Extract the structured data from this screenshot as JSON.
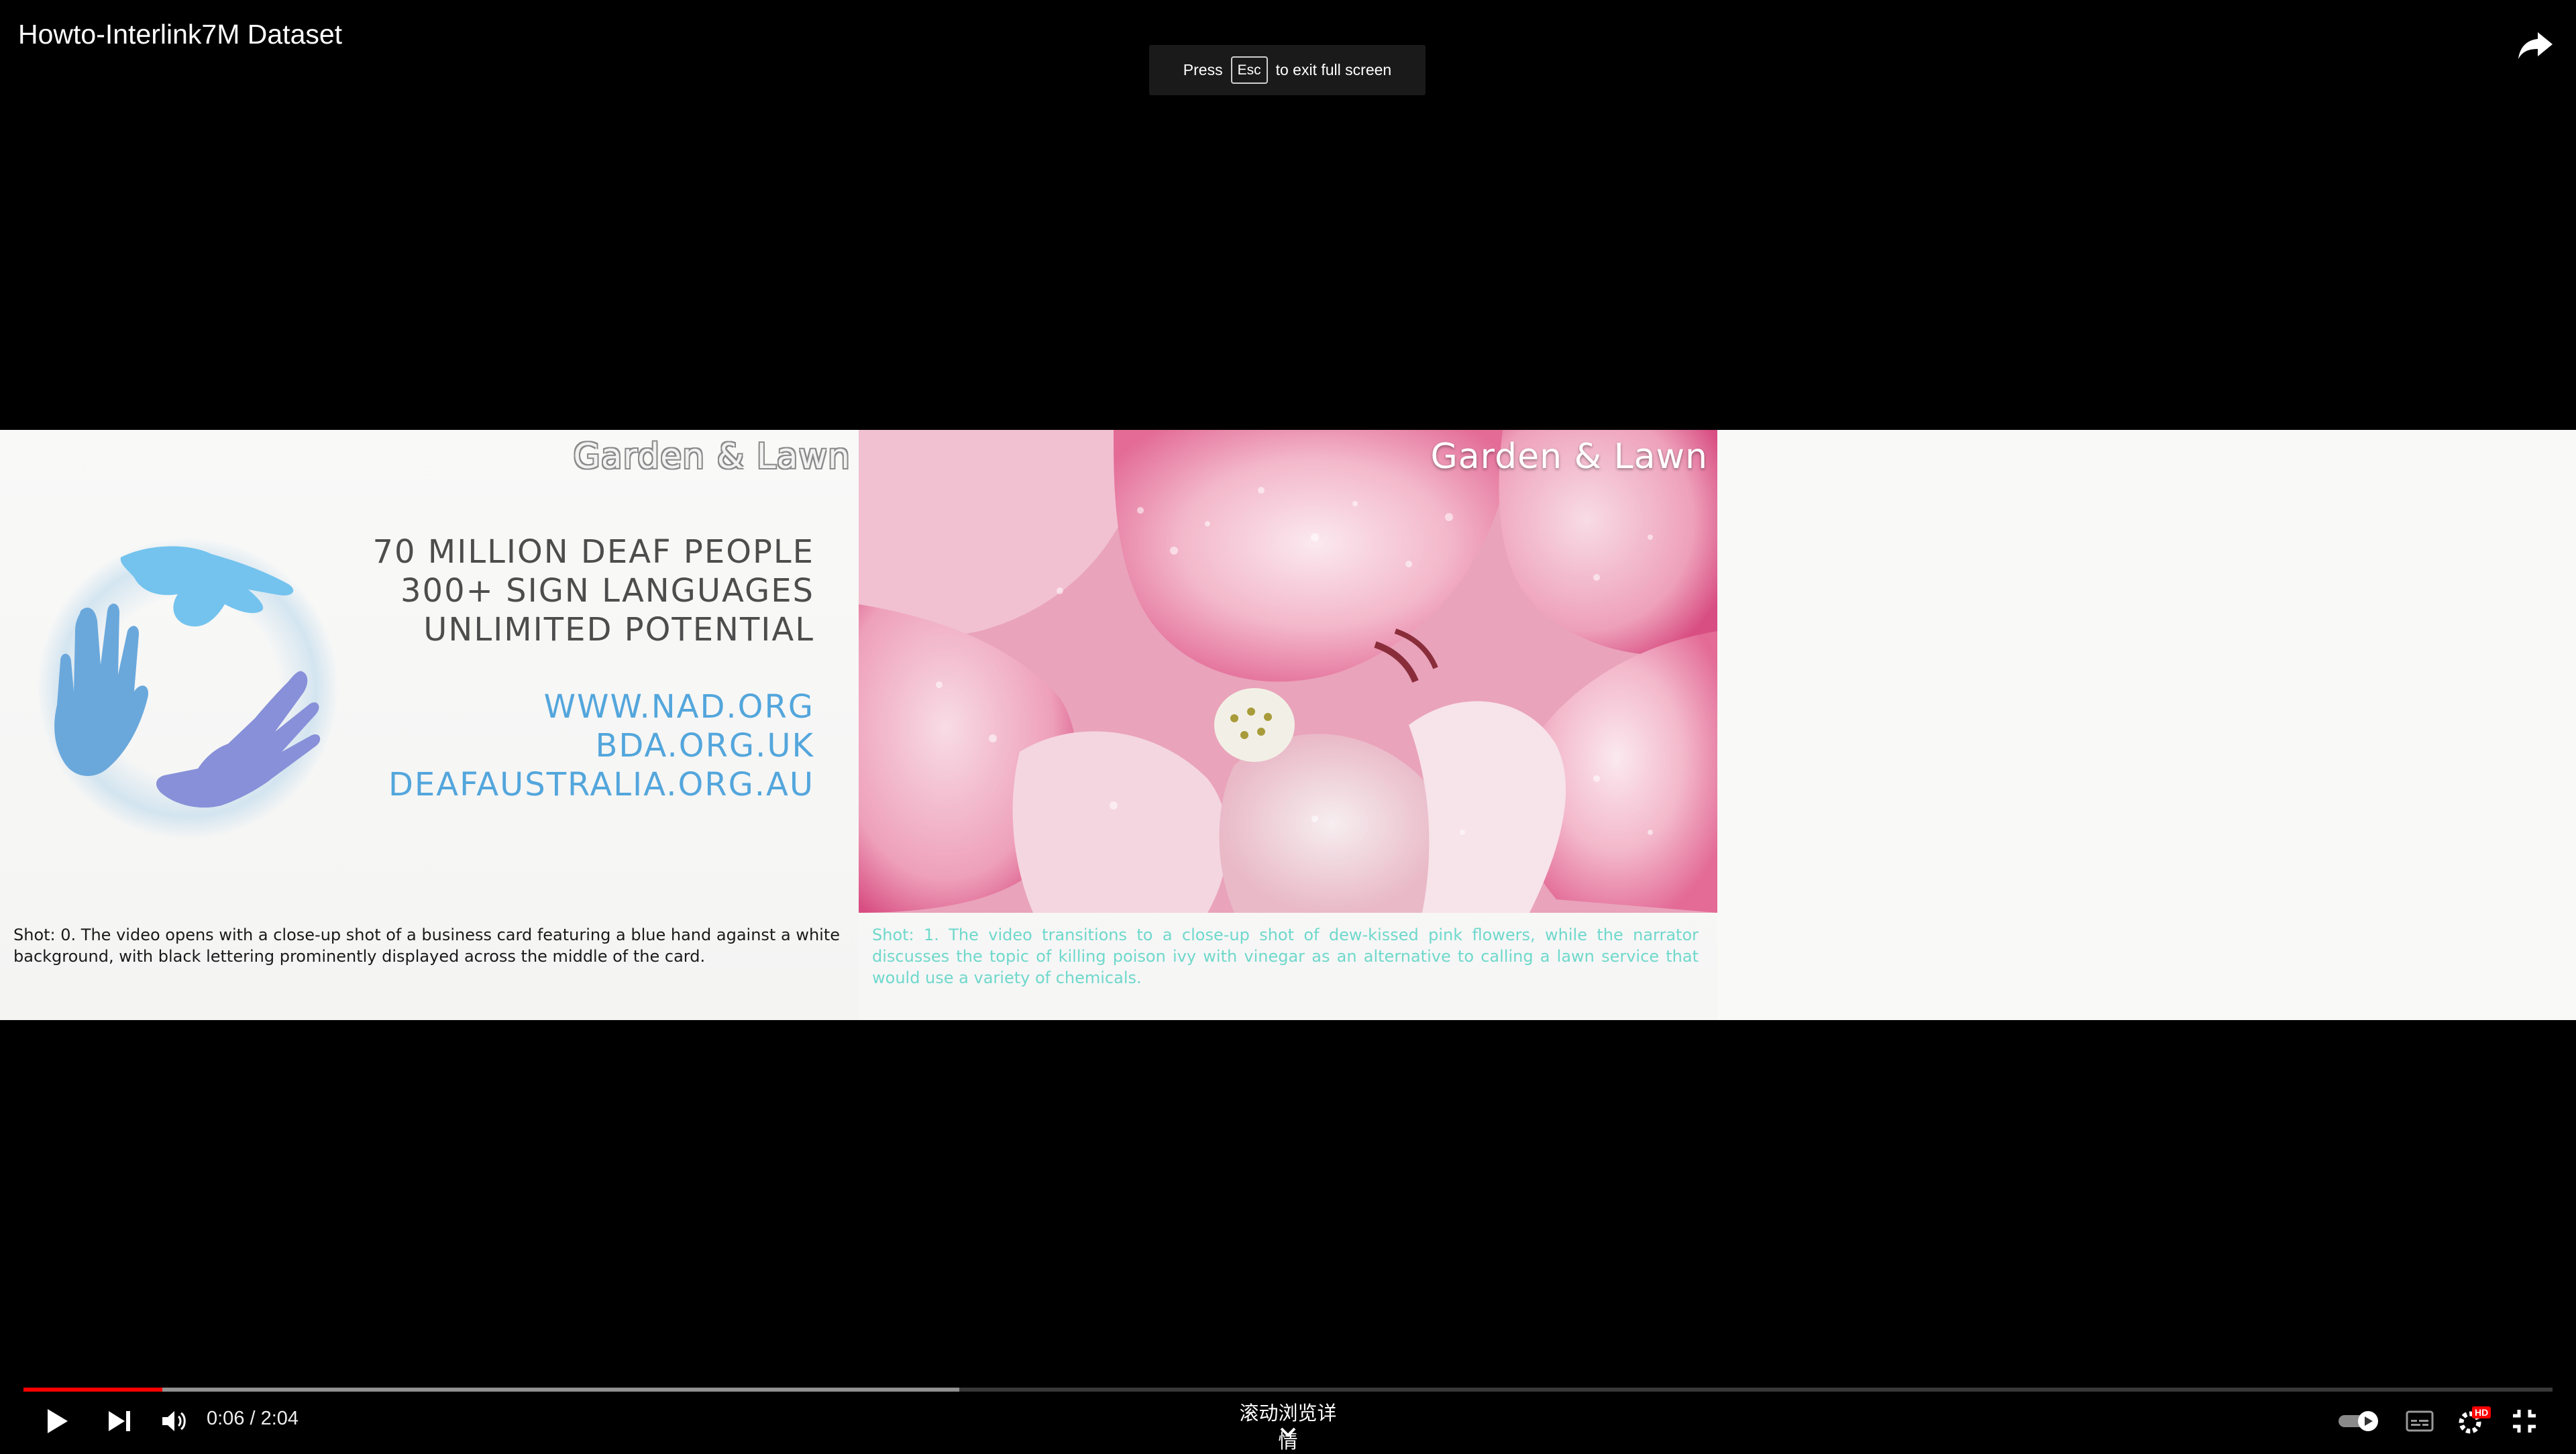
{
  "window": {
    "title": "Howto-Interlink7M Dataset"
  },
  "toast": {
    "press": "Press",
    "key": "Esc",
    "message": "to exit full screen"
  },
  "video": {
    "watermark_left": "Garden & Lawn",
    "watermark_mid": "Garden & Lawn",
    "card_lines": [
      "70 MILLION DEAF PEOPLE",
      "300+ SIGN LANGUAGES",
      "UNLIMITED POTENTIAL"
    ],
    "card_links": [
      "WWW.NAD.ORG",
      "BDA.ORG.UK",
      "DEAFAUSTRALIA.ORG.AU"
    ],
    "caption_left": "Shot: 0. The video opens with a close-up shot of a business card featuring a blue hand against a white background, with black lettering prominently displayed across the middle of the card.",
    "caption_mid": "Shot: 1. The video transitions to a close-up shot of dew-kissed pink flowers, while the narrator discusses the topic of killing poison ivy with vinegar as an alternative to calling a lawn service that would use a variety of chemicals."
  },
  "player": {
    "current_time": "0:06",
    "duration": "2:04",
    "time_display": "0:06 / 2:04",
    "progress_played": 0.055,
    "progress_buffered": 0.37,
    "scroll_hint": "滚动浏览详情",
    "quality_badge": "HD",
    "accent_color": "#ff0000"
  },
  "icons": {
    "share": "share-icon",
    "play": "play-icon",
    "next": "next-icon",
    "volume": "volume-icon",
    "autoplay": "autoplay-toggle-icon",
    "subtitles": "subtitles-icon",
    "settings": "settings-icon",
    "exit_fullscreen": "exit-fullscreen-icon",
    "chevron": "chevron-down-icon"
  }
}
